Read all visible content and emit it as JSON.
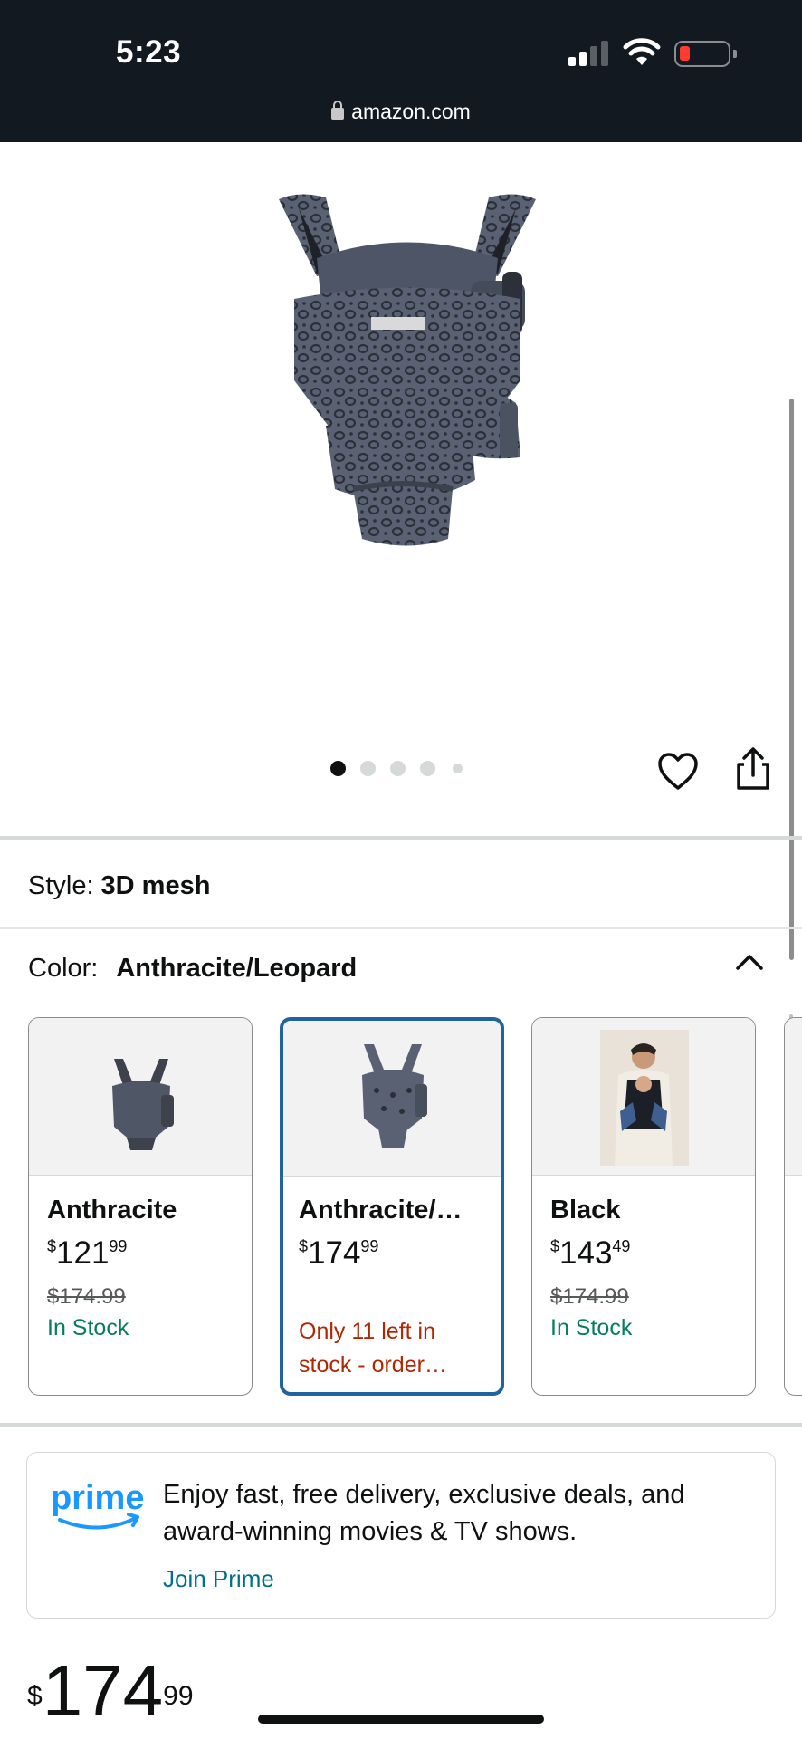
{
  "status_bar": {
    "time": "5:23"
  },
  "browser": {
    "url": "amazon.com"
  },
  "gallery": {
    "image_count": 5,
    "active_index": 0
  },
  "style_row": {
    "label": "Style:",
    "value": "3D mesh"
  },
  "color_row": {
    "label": "Color:",
    "value": "Anthracite/Leopard"
  },
  "swatches": [
    {
      "name": "Anthracite",
      "currency": "$",
      "price_whole": "121",
      "price_frac": "99",
      "list_price": "$174.99",
      "availability": "In Stock"
    },
    {
      "name": "Anthracite/…",
      "currency": "$",
      "price_whole": "174",
      "price_frac": "99",
      "availability": "Only 11 left in stock - order…"
    },
    {
      "name": "Black",
      "currency": "$",
      "price_whole": "143",
      "price_frac": "49",
      "list_price": "$174.99",
      "availability": "In Stock"
    }
  ],
  "prime": {
    "logo_text": "prime",
    "message": "Enjoy fast, free delivery, exclusive deals, and award-winning movies & TV shows.",
    "link": "Join Prime"
  },
  "price": {
    "currency": "$",
    "whole": "174",
    "frac": "99"
  },
  "colors": {
    "link": "#007185",
    "in_stock": "#067d62",
    "low_stock": "#b12704",
    "selected_border": "#2162a1",
    "header_bg": "#131921"
  }
}
